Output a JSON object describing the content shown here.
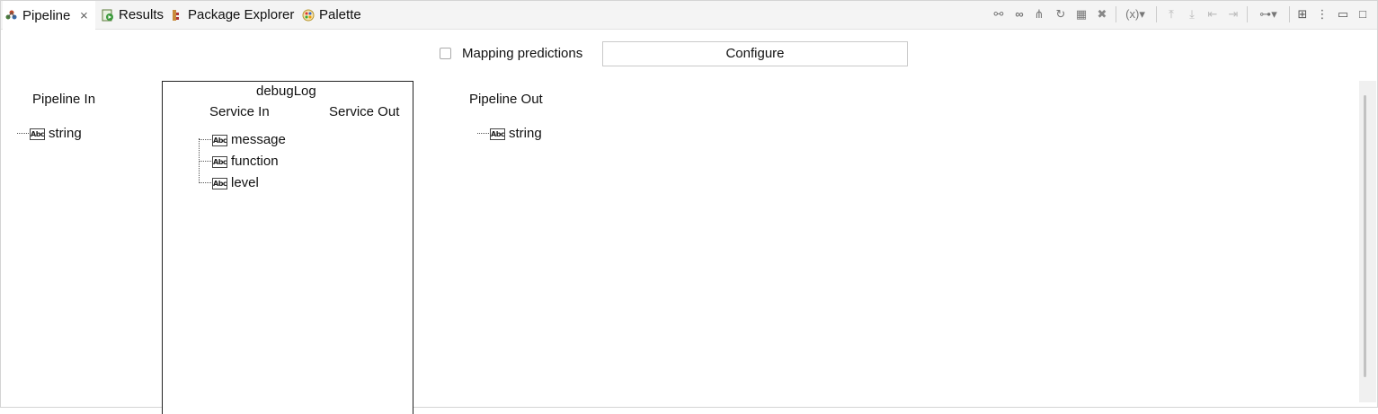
{
  "tabs": [
    {
      "label": "Pipeline",
      "icon": "pipeline-icon",
      "active": true,
      "closable": true
    },
    {
      "label": "Results",
      "icon": "results-icon",
      "active": false
    },
    {
      "label": "Package Explorer",
      "icon": "package-explorer-icon",
      "active": false
    },
    {
      "label": "Palette",
      "icon": "palette-icon",
      "active": false
    }
  ],
  "toolbar": {
    "icons": [
      "link-icon",
      "infinity-icon",
      "branch-icon",
      "step-icon",
      "grid-icon",
      "delete-icon",
      "variable-icon",
      "move-up-icon",
      "move-down-icon",
      "shift-left-icon",
      "shift-right-icon",
      "toggle-icon",
      "layout-icon",
      "more-icon",
      "minimize-icon",
      "maximize-icon"
    ]
  },
  "mapping": {
    "checkbox_label": "Mapping predictions",
    "checked": false,
    "configure_label": "Configure"
  },
  "pipeline_in": {
    "title": "Pipeline In",
    "fields": [
      {
        "name": "string",
        "type_badge": "Abc"
      }
    ]
  },
  "service": {
    "name": "debugLog",
    "in_title": "Service In",
    "out_title": "Service Out",
    "in_fields": [
      {
        "name": "message",
        "type_badge": "Abc"
      },
      {
        "name": "function",
        "type_badge": "Abc"
      },
      {
        "name": "level",
        "type_badge": "Abc"
      }
    ]
  },
  "pipeline_out": {
    "title": "Pipeline Out",
    "fields": [
      {
        "name": "string",
        "type_badge": "Abc"
      }
    ]
  }
}
